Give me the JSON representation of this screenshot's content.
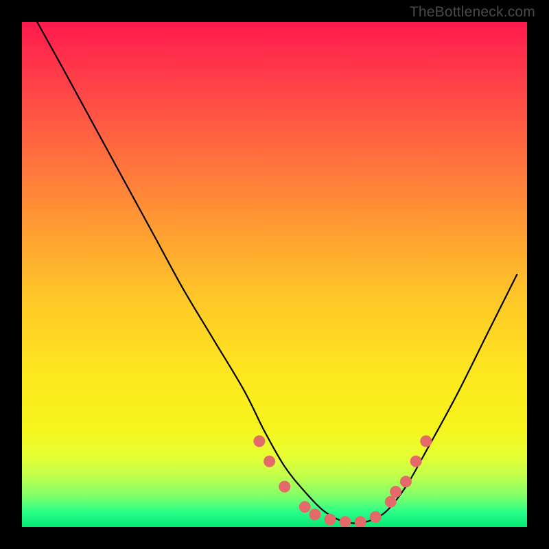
{
  "watermark": "TheBottleneck.com",
  "chart_data": {
    "type": "line",
    "title": "",
    "xlabel": "",
    "ylabel": "",
    "xlim": [
      0,
      100
    ],
    "ylim": [
      0,
      100
    ],
    "grid": false,
    "legend": false,
    "series": [
      {
        "name": "curve",
        "x": [
          3,
          8,
          14,
          20,
          26,
          32,
          38,
          44,
          48,
          52,
          56,
          60,
          64,
          68,
          72,
          76,
          80,
          86,
          92,
          98
        ],
        "y": [
          100,
          91,
          80,
          69,
          58,
          47,
          37,
          27,
          19,
          12,
          7,
          3,
          1,
          1,
          3,
          8,
          15,
          26,
          38,
          50
        ]
      }
    ],
    "markers": {
      "name": "points",
      "color": "#e46a6a",
      "x": [
        47,
        49,
        52,
        56,
        58,
        61,
        64,
        67,
        70,
        73,
        74,
        76,
        78,
        80
      ],
      "y": [
        17,
        13,
        8,
        4,
        2.5,
        1.5,
        1,
        1,
        2,
        5,
        7,
        9,
        13,
        17
      ]
    }
  }
}
